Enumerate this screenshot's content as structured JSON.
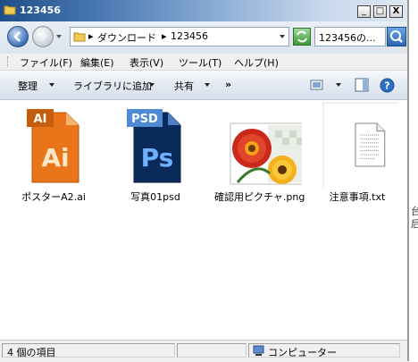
{
  "window": {
    "title": "123456",
    "controls": {
      "minimize": "_",
      "maximize": "□",
      "close": "X"
    }
  },
  "address": {
    "segments": [
      "ダウンロード",
      "123456"
    ],
    "search_value": "123456の..."
  },
  "menu": {
    "items": [
      "ファイル(F)",
      "編集(E)",
      "表示(V)",
      "ツール(T)",
      "ヘルプ(H)"
    ]
  },
  "commands": {
    "organize": "整理",
    "add_to_library": "ライブラリに追加",
    "share": "共有",
    "more": "»"
  },
  "files": [
    {
      "name": "ポスターA2.ai",
      "icon": "illustrator-file-icon",
      "badge": "Ai",
      "tab": "AI"
    },
    {
      "name": "写真01psd",
      "icon": "photoshop-file-icon",
      "badge": "Ps",
      "tab": "PSD"
    },
    {
      "name": "確認用ピクチャ.png",
      "icon": "png-image-thumbnail"
    },
    {
      "name": "注意事項.txt",
      "icon": "text-file-icon"
    }
  ],
  "status": {
    "item_count": "4 個の項目",
    "location": "コンピューター"
  },
  "background_fragments": [
    "台",
    "后"
  ],
  "colors": {
    "titlebar_start": "#1f4f8a",
    "illustrator_orange": "#e8751a",
    "photoshop_blue": "#0b2a5c"
  }
}
